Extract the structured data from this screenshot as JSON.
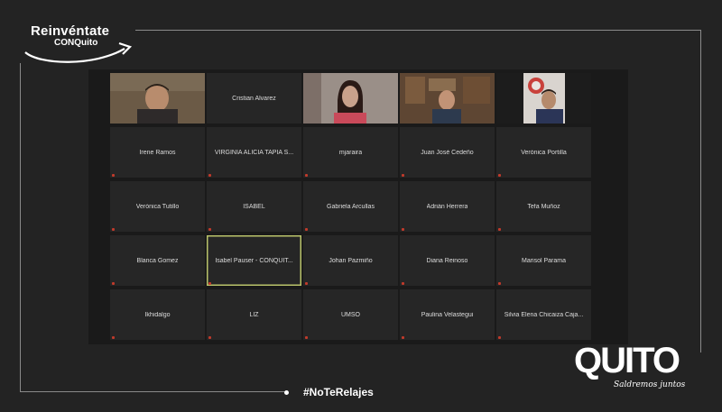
{
  "brand": {
    "title": "Reinvéntate",
    "subtitle": "CONQuito"
  },
  "meeting": {
    "participants": [
      {
        "name": "",
        "video": true,
        "active": false
      },
      {
        "name": "Cristian Alvarez",
        "video": false,
        "active": false
      },
      {
        "name": "",
        "video": true,
        "active": false
      },
      {
        "name": "",
        "video": true,
        "active": false
      },
      {
        "name": "",
        "video": true,
        "active": false
      },
      {
        "name": "Irene Ramos",
        "video": false,
        "active": false
      },
      {
        "name": "VIRGINIA ALICIA TAPIA S...",
        "video": false,
        "active": false
      },
      {
        "name": "mjaraira",
        "video": false,
        "active": false
      },
      {
        "name": "Juan José Cedeño",
        "video": false,
        "active": false
      },
      {
        "name": "Verónica Portilla",
        "video": false,
        "active": false
      },
      {
        "name": "Verónica Tutillo",
        "video": false,
        "active": false
      },
      {
        "name": "ISABEL",
        "video": false,
        "active": false
      },
      {
        "name": "Gabriela Arcullas",
        "video": false,
        "active": false
      },
      {
        "name": "Adrián Herrera",
        "video": false,
        "active": false
      },
      {
        "name": "Tefa Muñoz",
        "video": false,
        "active": false
      },
      {
        "name": "Blanca Gomez",
        "video": false,
        "active": false
      },
      {
        "name": "Isabel Pauser - CONQUIT...",
        "video": false,
        "active": true
      },
      {
        "name": "Johan Pazmiño",
        "video": false,
        "active": false
      },
      {
        "name": "Diana Reinoso",
        "video": false,
        "active": false
      },
      {
        "name": "Marisol Parama",
        "video": false,
        "active": false
      },
      {
        "name": "Ikhidalgo",
        "video": false,
        "active": false
      },
      {
        "name": "LIZ",
        "video": false,
        "active": false
      },
      {
        "name": "UMSO",
        "video": false,
        "active": false
      },
      {
        "name": "Paulina Velastegui",
        "video": false,
        "active": false
      },
      {
        "name": "Silvia Elena Chicaiza Caja...",
        "video": false,
        "active": false
      }
    ]
  },
  "footer": {
    "hashtag": "#NoTeRelajes"
  },
  "logo": {
    "word": "QUITO",
    "tagline": "Saldremos juntos"
  },
  "colors": {
    "background": "#232323",
    "tile": "#262626",
    "active_border": "#b9c36a"
  }
}
